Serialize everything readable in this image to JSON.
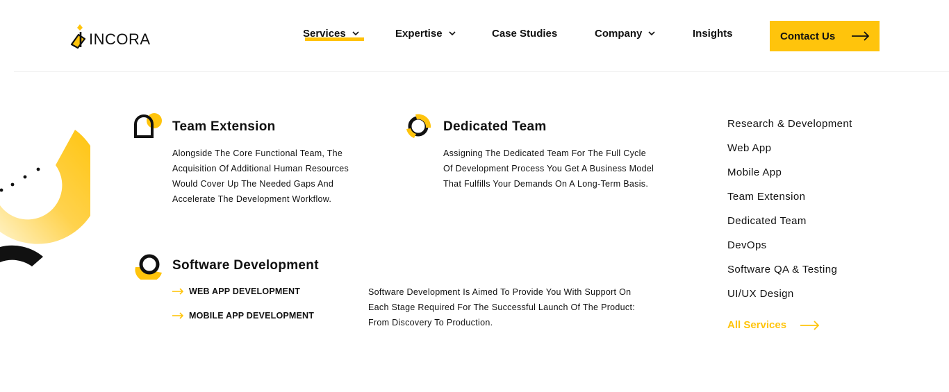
{
  "brand": {
    "name": "INCORA",
    "accent": "#ffc40c",
    "text_color": "#111111"
  },
  "nav": {
    "items": [
      {
        "label": "Services",
        "has_dropdown": true,
        "active": true
      },
      {
        "label": "Expertise",
        "has_dropdown": true,
        "active": false
      },
      {
        "label": "Case Studies",
        "has_dropdown": false,
        "active": false
      },
      {
        "label": "Company",
        "has_dropdown": true,
        "active": false
      },
      {
        "label": "Insights",
        "has_dropdown": false,
        "active": false
      }
    ],
    "cta_label": "Contact Us"
  },
  "services": {
    "team_extension": {
      "title": "Team Extension",
      "description": "Alongside The Core Functional Team, The Acquisition Of Additional Human Resources Would Cover Up The Needed Gaps And Accelerate The Development Workflow."
    },
    "dedicated_team": {
      "title": "Dedicated Team",
      "description": "Assigning The Dedicated Team For The Full Cycle Of Development Process You Get A Business Model That Fulfills Your Demands On A Long-Term Basis."
    },
    "software_development": {
      "title": "Software Development",
      "description": "Software Development Is Aimed To Provide You With Support On Each Stage Required For The Successful Launch Of The Product: From Discovery To Production.",
      "sub_links": [
        "WEB APP DEVELOPMENT",
        "MOBILE APP DEVELOPMENT"
      ]
    }
  },
  "side_menu": {
    "items": [
      "Research & Development",
      "Web App",
      "Mobile App",
      "Team Extension",
      "Dedicated Team",
      "DevOps",
      "Software QA & Testing",
      "UI/UX Design"
    ],
    "all_services_label": "All Services"
  },
  "icons": {
    "chevron": "chevron-down-icon",
    "arrow": "arrow-right-icon",
    "logo": "incora-logo-icon"
  }
}
